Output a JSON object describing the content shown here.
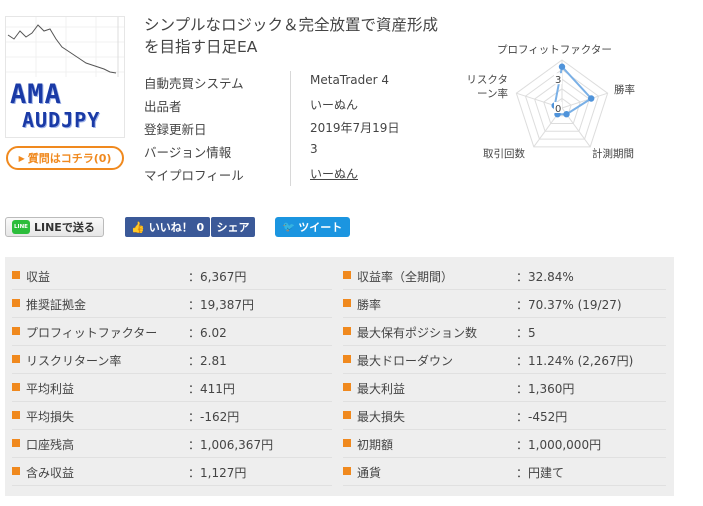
{
  "product": {
    "thumb_title": "AMA",
    "thumb_subtitle": "AUDJPY",
    "question_button": "質問はコチラ(0)",
    "title": "シンプルなロジック＆完全放置で資産形成を目指す日足EA"
  },
  "info": [
    {
      "key": "自動売買システム",
      "value": "MetaTrader 4",
      "link": false
    },
    {
      "key": "出品者",
      "value": "いーぬん",
      "link": false
    },
    {
      "key": "登録更新日",
      "value": "2019年7月19日",
      "link": false
    },
    {
      "key": "バージョン情報",
      "value": "3",
      "link": false
    },
    {
      "key": "マイプロフィール",
      "value": "いーぬん",
      "link": true
    }
  ],
  "chart_data": {
    "type": "radar",
    "axes": [
      "プロフィットファクター",
      "勝率",
      "計測期間",
      "取引回数",
      "リスクターン率"
    ],
    "tick_labels": [
      "0",
      "3"
    ],
    "range": [
      0,
      5
    ],
    "series": [
      {
        "values": [
          4.3,
          3.2,
          0.8,
          0.8,
          0.8
        ]
      }
    ],
    "colors": {
      "grid": "#dddddd",
      "series": "#7ab0e6",
      "point": "#4f93da"
    }
  },
  "social": {
    "line": "LINEで送る",
    "line_icon": "LINE",
    "like": "いいね！ 0",
    "share": "シェア",
    "tweet": "ツイート"
  },
  "stats": {
    "left": [
      {
        "key": "収益",
        "value": "：6,367円"
      },
      {
        "key": "推奨証拠金",
        "value": "：19,387円"
      },
      {
        "key": "プロフィットファクター",
        "value": "：6.02"
      },
      {
        "key": "リスクリターン率",
        "value": "：2.81"
      },
      {
        "key": "平均利益",
        "value": "：411円"
      },
      {
        "key": "平均損失",
        "value": "：-162円"
      },
      {
        "key": "口座残高",
        "value": "：1,006,367円"
      },
      {
        "key": "含み収益",
        "value": "：1,127円"
      }
    ],
    "right": [
      {
        "key": "収益率（全期間）",
        "value": "：32.84%"
      },
      {
        "key": "勝率",
        "value": "：70.37% (19/27)"
      },
      {
        "key": "最大保有ポジション数",
        "value": "：5"
      },
      {
        "key": "最大ドローダウン",
        "value": "：11.24% (2,267円)"
      },
      {
        "key": "最大利益",
        "value": "：1,360円"
      },
      {
        "key": "最大損失",
        "value": "：-452円"
      },
      {
        "key": "初期額",
        "value": "：1,000,000円"
      },
      {
        "key": "通貨",
        "value": "：円建て"
      }
    ]
  },
  "colors": {
    "accent": "#f0891e",
    "facebook": "#3b5998",
    "twitter": "#1b95e0",
    "line": "#2cbd3b"
  }
}
